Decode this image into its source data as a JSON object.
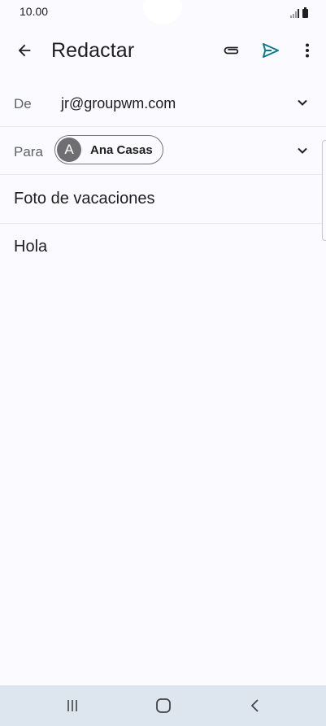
{
  "status_bar": {
    "time": "10.00"
  },
  "app_bar": {
    "title": "Redactar",
    "back_icon": "arrow-back-icon",
    "attach_icon": "paperclip-icon",
    "send_icon": "send-icon",
    "more_icon": "more-vert-icon"
  },
  "from_field": {
    "label": "De",
    "value": "jr@groupwm.com"
  },
  "to_field": {
    "label": "Para",
    "recipient": {
      "initial": "A",
      "name": "Ana Casas"
    }
  },
  "subject": {
    "value": "Foto de vacaciones"
  },
  "body": {
    "value": "Hola"
  },
  "colors": {
    "background": "#fafaff",
    "send_accent": "#0b7a8f",
    "nav_bar": "#dde6ef",
    "avatar": "#6f6f72"
  }
}
